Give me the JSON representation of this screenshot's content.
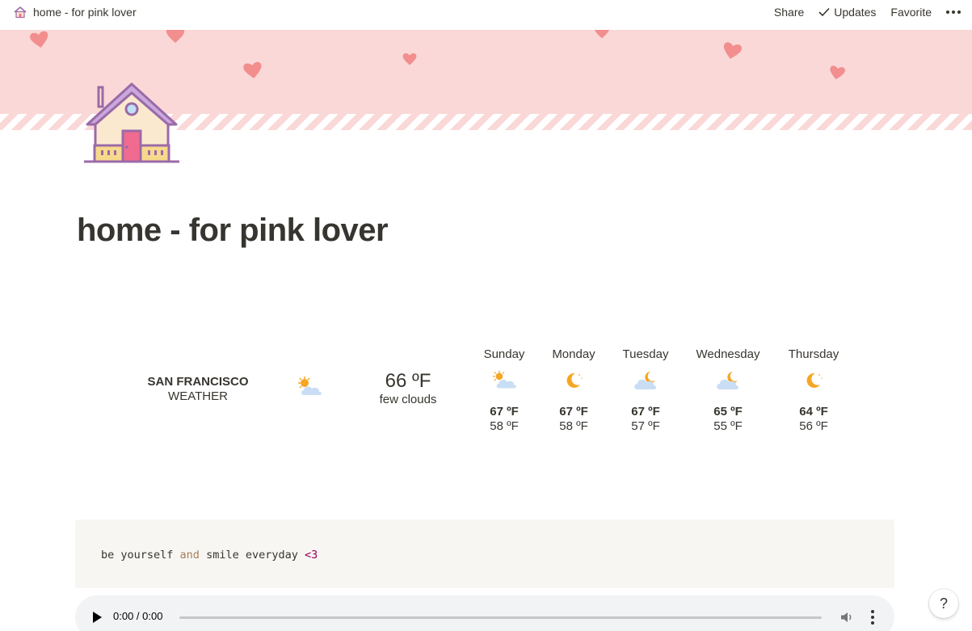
{
  "topbar": {
    "breadcrumb_title": "home - for pink lover",
    "share_label": "Share",
    "updates_label": "Updates",
    "favorite_label": "Favorite"
  },
  "page": {
    "title": "home - for pink lover"
  },
  "weather": {
    "city": "SAN FRANCISCO",
    "label": "WEATHER",
    "current_temp": "66 ºF",
    "current_desc": "few clouds",
    "current_icon": "sun-cloud-icon",
    "days": [
      {
        "name": "Sunday",
        "icon": "sun-cloud-icon",
        "hi": "67 ºF",
        "lo": "58 ºF"
      },
      {
        "name": "Monday",
        "icon": "moon-icon",
        "hi": "67 ºF",
        "lo": "58 ºF"
      },
      {
        "name": "Tuesday",
        "icon": "moon-cloud-icon",
        "hi": "67 ºF",
        "lo": "57 ºF"
      },
      {
        "name": "Wednesday",
        "icon": "moon-cloud-icon",
        "hi": "65 ºF",
        "lo": "55 ºF"
      },
      {
        "name": "Thursday",
        "icon": "moon-icon",
        "hi": "64 ºF",
        "lo": "56 ºF"
      }
    ]
  },
  "code": {
    "part1": "be yourself ",
    "part2": "and",
    "part3": " smile everyday ",
    "part4": "<3"
  },
  "audio": {
    "time": "0:00 / 0:00"
  },
  "help": {
    "label": "?"
  },
  "colors": {
    "cover": "#f9d8d7",
    "heart": "#f28e8e",
    "text": "#37352f"
  }
}
